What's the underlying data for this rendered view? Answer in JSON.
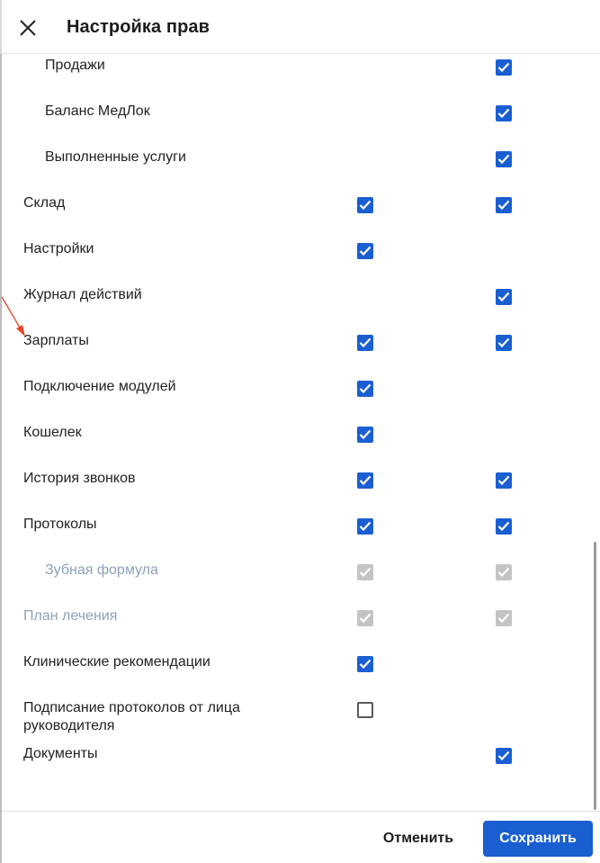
{
  "header": {
    "title": "Настройка прав",
    "close_icon": "close-icon"
  },
  "rows": [
    {
      "label": "Продажи",
      "level": "child",
      "col1": "none",
      "col2": "checked"
    },
    {
      "label": "Баланс МедЛок",
      "level": "child",
      "col1": "none",
      "col2": "checked"
    },
    {
      "label": "Выполненные услуги",
      "level": "child",
      "col1": "none",
      "col2": "checked"
    },
    {
      "label": "Склад",
      "level": "root",
      "col1": "checked",
      "col2": "checked"
    },
    {
      "label": "Настройки",
      "level": "root",
      "col1": "checked",
      "col2": "none"
    },
    {
      "label": "Журнал действий",
      "level": "root",
      "col1": "none",
      "col2": "checked"
    },
    {
      "label": "Зарплаты",
      "level": "root",
      "col1": "checked",
      "col2": "checked"
    },
    {
      "label": "Подключение модулей",
      "level": "root",
      "col1": "checked",
      "col2": "none"
    },
    {
      "label": "Кошелек",
      "level": "root",
      "col1": "checked",
      "col2": "none"
    },
    {
      "label": "История звонков",
      "level": "root",
      "col1": "checked",
      "col2": "checked"
    },
    {
      "label": "Протоколы",
      "level": "root",
      "col1": "checked",
      "col2": "checked"
    },
    {
      "label": "Зубная формула",
      "level": "child",
      "col1": "disabled",
      "col2": "disabled",
      "disabled": true
    },
    {
      "label": "План лечения",
      "level": "root",
      "col1": "disabled",
      "col2": "disabled",
      "disabled": true
    },
    {
      "label": "Клинические рекомендации",
      "level": "root",
      "col1": "checked",
      "col2": "none"
    },
    {
      "label": "Подписание протоколов от лица руководителя",
      "level": "root",
      "col1": "empty",
      "col2": "none",
      "two_line": true
    },
    {
      "label": "Документы",
      "level": "root",
      "col1": "none",
      "col2": "checked"
    }
  ],
  "footer": {
    "cancel_label": "Отменить",
    "save_label": "Сохранить"
  },
  "colors": {
    "accent": "#1a5fd1",
    "disabled_text": "#8da1b8",
    "disabled_checkbox": "#c4c4c4",
    "arrow": "#e8462b"
  }
}
